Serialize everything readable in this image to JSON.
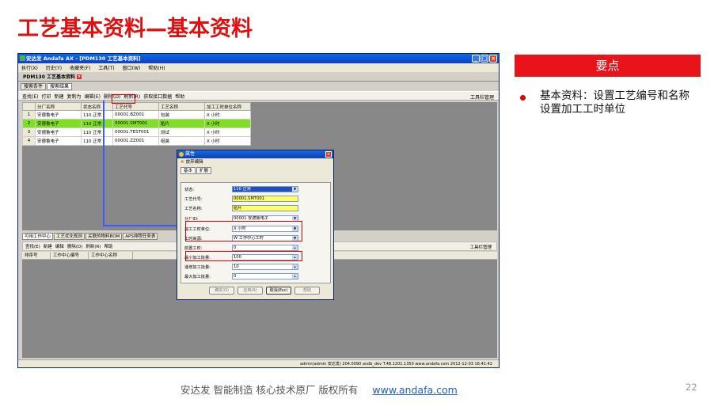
{
  "slide": {
    "title": "工艺基本资料—基本资料",
    "keypoints_header": "要点",
    "keypoints_text": "基本资料：设置工艺编号和名称设置加工工时单位",
    "footer_text": "安达发   智能制造 核心技术原厂    版权所有",
    "footer_link": "www.andafa.com",
    "page_number": "22"
  },
  "app": {
    "window_title": "安达发 Andafa AX - [PDM130 工艺基本资料]",
    "menu": [
      "执行(X)",
      "历史(Y)",
      "收藏夹(F)",
      "工具(T)",
      "窗口(W)",
      "帮助(H)"
    ],
    "doc_tab": "PDM130 工艺基本资料",
    "subtabs": [
      "搜索条件",
      "搜索结果"
    ],
    "toolbar": [
      "查找(E)",
      "打印",
      "新建",
      "复制为",
      "编辑(E)",
      "删除(D)",
      "刷新(R)",
      "获取接口数据",
      "帮助"
    ],
    "toolbar_right": "工具栏管理",
    "grid": {
      "columns": [
        "分厂名称",
        "状态名称",
        "工艺代号",
        "工艺名称",
        "加工工时单位名称"
      ],
      "rows": [
        {
          "no": "1",
          "cells": [
            "安德鲁电子",
            "110 正常",
            "00001.BZ001",
            "包装",
            "X 小时"
          ]
        },
        {
          "no": "2",
          "cells": [
            "安德鲁电子",
            "110 正常",
            "00001.SMT001",
            "贴片",
            "X 小时"
          ]
        },
        {
          "no": "3",
          "cells": [
            "安德鲁电子",
            "110 正常",
            "00001.TEST001",
            "测试",
            "X 小时"
          ]
        },
        {
          "no": "4",
          "cells": [
            "安德鲁电子",
            "110 正常",
            "00001.ZZ001",
            "组装",
            "X 小时"
          ]
        }
      ]
    },
    "bottom_tabs": [
      "可用工作中心",
      "工艺优化规则",
      "关联的物料BOM",
      "APS排程任务表"
    ],
    "toolbar2": [
      "查找(E)",
      "新建",
      "编辑",
      "删除(D)",
      "刷新(R)",
      "帮助"
    ],
    "grid2_columns": [
      "排序号",
      "工作中心编号",
      "工作中心名称"
    ],
    "status_bar": "admin(admin 安达发)  204.0090  andb_dev  T.48.1201.1350  www.andafa.com  2012-12-03 16:41:42",
    "dialog": {
      "title": "属性",
      "tool": "放弃编辑",
      "tabs": [
        "基本",
        "扩展"
      ],
      "fields": [
        {
          "label": "状态:",
          "value": "110 正常"
        },
        {
          "label": "工艺代号:",
          "value": "00001.SMT001"
        },
        {
          "label": "工艺名称:",
          "value": "贴片"
        },
        {
          "label": "分厂ID:",
          "value": "00001 安德鲁电子"
        },
        {
          "label": "加工工时单位:",
          "value": "X 小时"
        },
        {
          "label": "工时来源:",
          "value": "W 工作中心工时"
        },
        {
          "label": "前置工时:",
          "value": "0"
        },
        {
          "label": "最小加工批量:",
          "value": "100"
        },
        {
          "label": "递增加工批量:",
          "value": "10"
        },
        {
          "label": "最大加工批量:",
          "value": "0"
        }
      ],
      "buttons": [
        "确定(O)",
        "应用(A)",
        "取消(Esc)",
        "帮助"
      ]
    }
  }
}
